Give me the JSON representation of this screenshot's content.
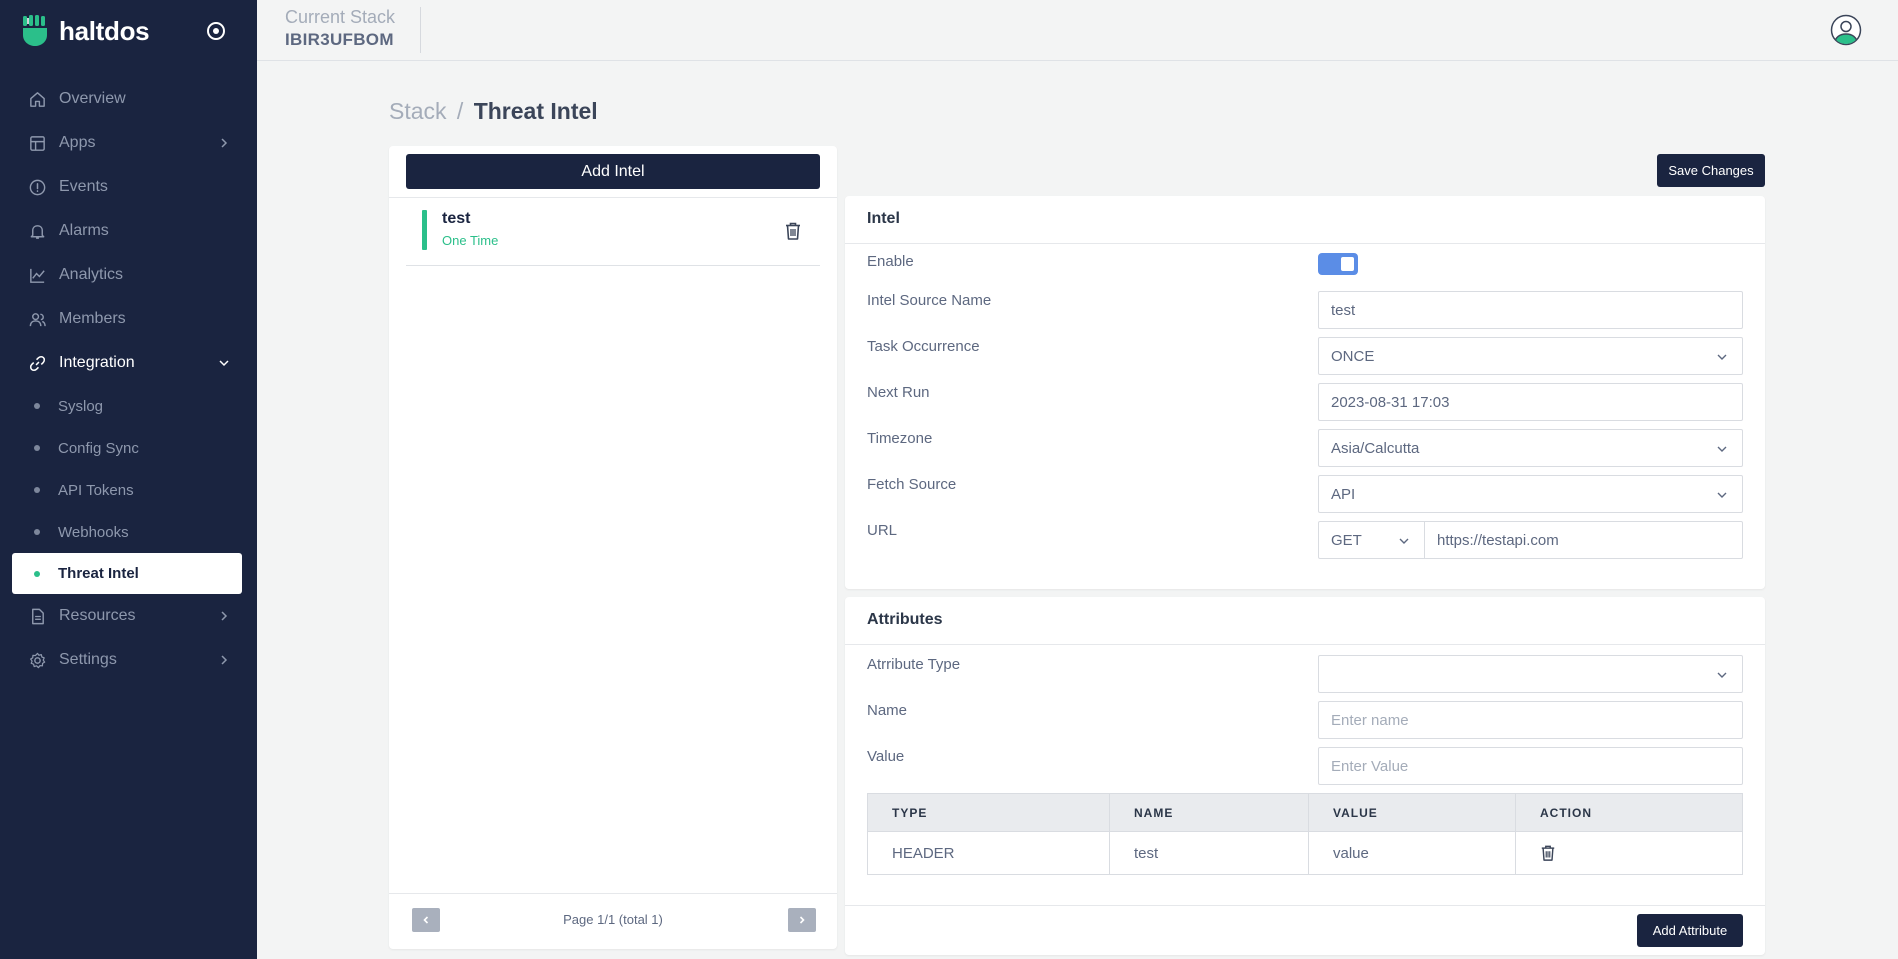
{
  "brand": {
    "name": "haltdos"
  },
  "sidebar": {
    "items": [
      {
        "label": "Overview",
        "icon": "home-icon"
      },
      {
        "label": "Apps",
        "icon": "layout-icon"
      },
      {
        "label": "Events",
        "icon": "alert-circle-icon"
      },
      {
        "label": "Alarms",
        "icon": "bell-icon"
      },
      {
        "label": "Analytics",
        "icon": "chart-line-icon"
      },
      {
        "label": "Members",
        "icon": "users-icon"
      },
      {
        "label": "Integration",
        "icon": "link-icon"
      },
      {
        "label": "Resources",
        "icon": "document-icon"
      },
      {
        "label": "Settings",
        "icon": "gear-icon"
      }
    ],
    "integration_sub": [
      {
        "label": "Syslog"
      },
      {
        "label": "Config Sync"
      },
      {
        "label": "API Tokens"
      },
      {
        "label": "Webhooks"
      },
      {
        "label": "Threat Intel"
      }
    ]
  },
  "header": {
    "stack_label": "Current Stack",
    "stack_value": "IBIR3UFBOM"
  },
  "breadcrumb": {
    "parent": "Stack",
    "separator": "/",
    "current": "Threat Intel"
  },
  "left_panel": {
    "add_button": "Add Intel",
    "items": [
      {
        "name": "test",
        "occurrence": "One Time"
      }
    ],
    "pager_text": "Page 1/1 (total 1)"
  },
  "toolbar": {
    "save_label": "Save Changes"
  },
  "intel": {
    "title": "Intel",
    "enable_label": "Enable",
    "enabled": true,
    "source_name_label": "Intel Source Name",
    "source_name_value": "test",
    "task_label": "Task Occurrence",
    "task_value": "ONCE",
    "next_run_label": "Next Run",
    "next_run_value": "2023-08-31 17:03",
    "timezone_label": "Timezone",
    "timezone_value": "Asia/Calcutta",
    "fetch_label": "Fetch Source",
    "fetch_value": "API",
    "url_label": "URL",
    "url_method": "GET",
    "url_value": "https://testapi.com"
  },
  "attributes": {
    "title": "Attributes",
    "type_label": "Atrribute Type",
    "type_value": "",
    "name_label": "Name",
    "name_placeholder": "Enter name",
    "value_label": "Value",
    "value_placeholder": "Enter Value",
    "columns": [
      "TYPE",
      "NAME",
      "VALUE",
      "ACTION"
    ],
    "rows": [
      {
        "type": "HEADER",
        "name": "test",
        "value": "value"
      }
    ],
    "add_label": "Add Attribute"
  },
  "colors": {
    "sidebar_bg": "#1a2440",
    "accent_green": "#2bbf8a",
    "toggle_blue": "#5b8de6"
  }
}
